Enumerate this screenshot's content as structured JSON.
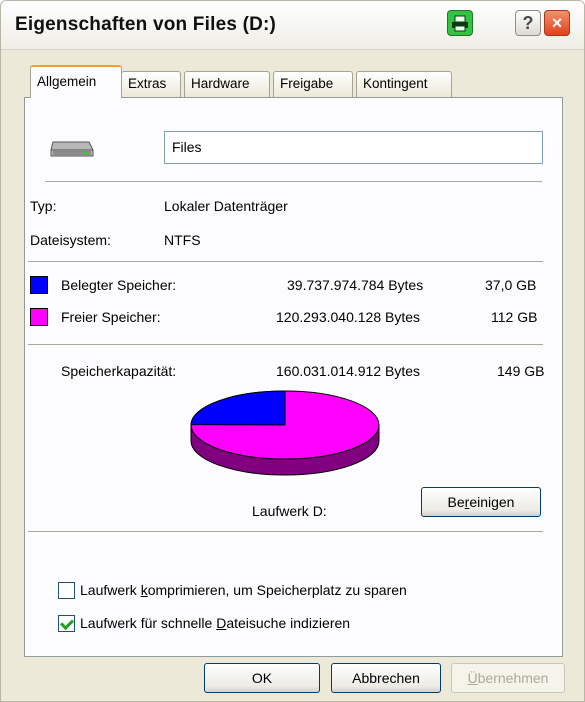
{
  "window": {
    "title": "Eigenschaften von Files (D:)",
    "help_glyph": "?",
    "close_glyph": "×"
  },
  "tabs": [
    "Allgemein",
    "Extras",
    "Hardware",
    "Freigabe",
    "Kontingent"
  ],
  "drive": {
    "name": "Files"
  },
  "info": {
    "type_label": "Typ:",
    "type_value": "Lokaler Datenträger",
    "fs_label": "Dateisystem:",
    "fs_value": "NTFS"
  },
  "usage": {
    "used_label": "Belegter Speicher:",
    "used_bytes": "39.737.974.784 Bytes",
    "used_size": "37,0 GB",
    "free_label": "Freier Speicher:",
    "free_bytes": "120.293.040.128 Bytes",
    "free_size": "112 GB",
    "capacity_label": "Speicherkapazität:",
    "capacity_bytes": "160.031.014.912 Bytes",
    "capacity_size": "149 GB",
    "used_fraction": 0.248,
    "used_color": "#0000ff",
    "free_color": "#ff00ff"
  },
  "drive_label": "Laufwerk D:",
  "cleanup_button": {
    "pre": "Be",
    "key": "r",
    "post": "einigen"
  },
  "options": {
    "compress": {
      "pre": "Laufwerk ",
      "key": "k",
      "post": "omprimieren, um Speicherplatz zu sparen",
      "checked": false
    },
    "index": {
      "pre": "Laufwerk für schnelle ",
      "key": "D",
      "post": "ateisuche indizieren",
      "checked": true
    }
  },
  "footer": {
    "ok": "OK",
    "cancel": "Abbrechen",
    "apply": {
      "key": "Ü",
      "post": "bernehmen"
    }
  }
}
